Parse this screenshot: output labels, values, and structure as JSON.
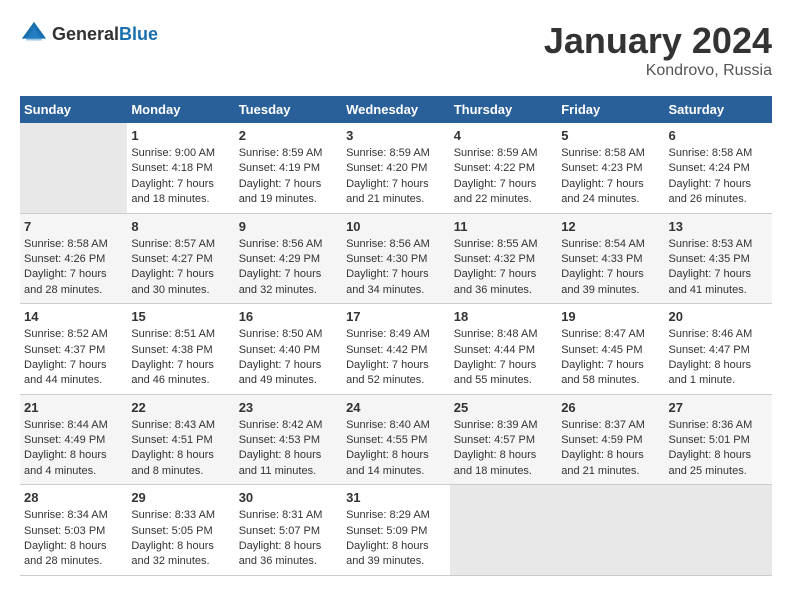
{
  "header": {
    "logo_general": "General",
    "logo_blue": "Blue",
    "month": "January 2024",
    "location": "Kondrovo, Russia"
  },
  "weekdays": [
    "Sunday",
    "Monday",
    "Tuesday",
    "Wednesday",
    "Thursday",
    "Friday",
    "Saturday"
  ],
  "weeks": [
    [
      {
        "day": "",
        "sunrise": "",
        "sunset": "",
        "daylight": "",
        "empty": true
      },
      {
        "day": "1",
        "sunrise": "Sunrise: 9:00 AM",
        "sunset": "Sunset: 4:18 PM",
        "daylight": "Daylight: 7 hours and 18 minutes."
      },
      {
        "day": "2",
        "sunrise": "Sunrise: 8:59 AM",
        "sunset": "Sunset: 4:19 PM",
        "daylight": "Daylight: 7 hours and 19 minutes."
      },
      {
        "day": "3",
        "sunrise": "Sunrise: 8:59 AM",
        "sunset": "Sunset: 4:20 PM",
        "daylight": "Daylight: 7 hours and 21 minutes."
      },
      {
        "day": "4",
        "sunrise": "Sunrise: 8:59 AM",
        "sunset": "Sunset: 4:22 PM",
        "daylight": "Daylight: 7 hours and 22 minutes."
      },
      {
        "day": "5",
        "sunrise": "Sunrise: 8:58 AM",
        "sunset": "Sunset: 4:23 PM",
        "daylight": "Daylight: 7 hours and 24 minutes."
      },
      {
        "day": "6",
        "sunrise": "Sunrise: 8:58 AM",
        "sunset": "Sunset: 4:24 PM",
        "daylight": "Daylight: 7 hours and 26 minutes."
      }
    ],
    [
      {
        "day": "7",
        "sunrise": "Sunrise: 8:58 AM",
        "sunset": "Sunset: 4:26 PM",
        "daylight": "Daylight: 7 hours and 28 minutes."
      },
      {
        "day": "8",
        "sunrise": "Sunrise: 8:57 AM",
        "sunset": "Sunset: 4:27 PM",
        "daylight": "Daylight: 7 hours and 30 minutes."
      },
      {
        "day": "9",
        "sunrise": "Sunrise: 8:56 AM",
        "sunset": "Sunset: 4:29 PM",
        "daylight": "Daylight: 7 hours and 32 minutes."
      },
      {
        "day": "10",
        "sunrise": "Sunrise: 8:56 AM",
        "sunset": "Sunset: 4:30 PM",
        "daylight": "Daylight: 7 hours and 34 minutes."
      },
      {
        "day": "11",
        "sunrise": "Sunrise: 8:55 AM",
        "sunset": "Sunset: 4:32 PM",
        "daylight": "Daylight: 7 hours and 36 minutes."
      },
      {
        "day": "12",
        "sunrise": "Sunrise: 8:54 AM",
        "sunset": "Sunset: 4:33 PM",
        "daylight": "Daylight: 7 hours and 39 minutes."
      },
      {
        "day": "13",
        "sunrise": "Sunrise: 8:53 AM",
        "sunset": "Sunset: 4:35 PM",
        "daylight": "Daylight: 7 hours and 41 minutes."
      }
    ],
    [
      {
        "day": "14",
        "sunrise": "Sunrise: 8:52 AM",
        "sunset": "Sunset: 4:37 PM",
        "daylight": "Daylight: 7 hours and 44 minutes."
      },
      {
        "day": "15",
        "sunrise": "Sunrise: 8:51 AM",
        "sunset": "Sunset: 4:38 PM",
        "daylight": "Daylight: 7 hours and 46 minutes."
      },
      {
        "day": "16",
        "sunrise": "Sunrise: 8:50 AM",
        "sunset": "Sunset: 4:40 PM",
        "daylight": "Daylight: 7 hours and 49 minutes."
      },
      {
        "day": "17",
        "sunrise": "Sunrise: 8:49 AM",
        "sunset": "Sunset: 4:42 PM",
        "daylight": "Daylight: 7 hours and 52 minutes."
      },
      {
        "day": "18",
        "sunrise": "Sunrise: 8:48 AM",
        "sunset": "Sunset: 4:44 PM",
        "daylight": "Daylight: 7 hours and 55 minutes."
      },
      {
        "day": "19",
        "sunrise": "Sunrise: 8:47 AM",
        "sunset": "Sunset: 4:45 PM",
        "daylight": "Daylight: 7 hours and 58 minutes."
      },
      {
        "day": "20",
        "sunrise": "Sunrise: 8:46 AM",
        "sunset": "Sunset: 4:47 PM",
        "daylight": "Daylight: 8 hours and 1 minute."
      }
    ],
    [
      {
        "day": "21",
        "sunrise": "Sunrise: 8:44 AM",
        "sunset": "Sunset: 4:49 PM",
        "daylight": "Daylight: 8 hours and 4 minutes."
      },
      {
        "day": "22",
        "sunrise": "Sunrise: 8:43 AM",
        "sunset": "Sunset: 4:51 PM",
        "daylight": "Daylight: 8 hours and 8 minutes."
      },
      {
        "day": "23",
        "sunrise": "Sunrise: 8:42 AM",
        "sunset": "Sunset: 4:53 PM",
        "daylight": "Daylight: 8 hours and 11 minutes."
      },
      {
        "day": "24",
        "sunrise": "Sunrise: 8:40 AM",
        "sunset": "Sunset: 4:55 PM",
        "daylight": "Daylight: 8 hours and 14 minutes."
      },
      {
        "day": "25",
        "sunrise": "Sunrise: 8:39 AM",
        "sunset": "Sunset: 4:57 PM",
        "daylight": "Daylight: 8 hours and 18 minutes."
      },
      {
        "day": "26",
        "sunrise": "Sunrise: 8:37 AM",
        "sunset": "Sunset: 4:59 PM",
        "daylight": "Daylight: 8 hours and 21 minutes."
      },
      {
        "day": "27",
        "sunrise": "Sunrise: 8:36 AM",
        "sunset": "Sunset: 5:01 PM",
        "daylight": "Daylight: 8 hours and 25 minutes."
      }
    ],
    [
      {
        "day": "28",
        "sunrise": "Sunrise: 8:34 AM",
        "sunset": "Sunset: 5:03 PM",
        "daylight": "Daylight: 8 hours and 28 minutes."
      },
      {
        "day": "29",
        "sunrise": "Sunrise: 8:33 AM",
        "sunset": "Sunset: 5:05 PM",
        "daylight": "Daylight: 8 hours and 32 minutes."
      },
      {
        "day": "30",
        "sunrise": "Sunrise: 8:31 AM",
        "sunset": "Sunset: 5:07 PM",
        "daylight": "Daylight: 8 hours and 36 minutes."
      },
      {
        "day": "31",
        "sunrise": "Sunrise: 8:29 AM",
        "sunset": "Sunset: 5:09 PM",
        "daylight": "Daylight: 8 hours and 39 minutes."
      },
      {
        "day": "",
        "sunrise": "",
        "sunset": "",
        "daylight": "",
        "empty": true
      },
      {
        "day": "",
        "sunrise": "",
        "sunset": "",
        "daylight": "",
        "empty": true
      },
      {
        "day": "",
        "sunrise": "",
        "sunset": "",
        "daylight": "",
        "empty": true
      }
    ]
  ]
}
